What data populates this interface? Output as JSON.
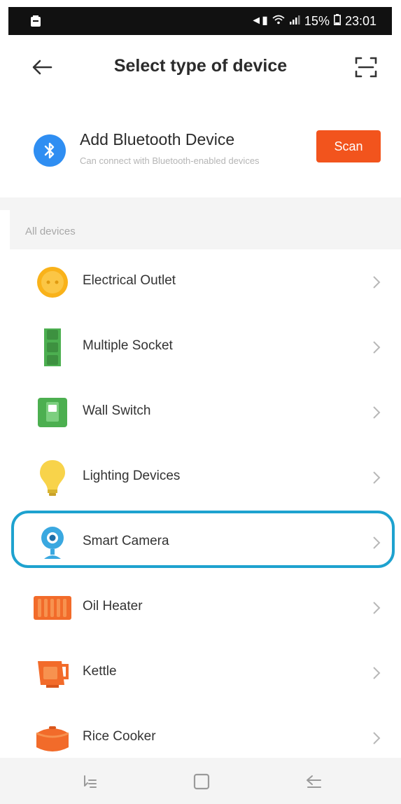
{
  "status_bar": {
    "battery": "15%",
    "time": "23:01"
  },
  "header": {
    "title": "Select type of device"
  },
  "bluetooth": {
    "title": "Add Bluetooth Device",
    "subtitle": "Can connect with Bluetooth-enabled devices",
    "scan_label": "Scan"
  },
  "section": {
    "label": "All devices"
  },
  "devices": [
    {
      "label": "Electrical Outlet",
      "icon": "outlet-icon"
    },
    {
      "label": "Multiple Socket",
      "icon": "power-strip-icon"
    },
    {
      "label": "Wall Switch",
      "icon": "wall-switch-icon"
    },
    {
      "label": "Lighting Devices",
      "icon": "light-bulb-icon"
    },
    {
      "label": "Smart Camera",
      "icon": "camera-icon"
    },
    {
      "label": "Oil Heater",
      "icon": "heater-icon"
    },
    {
      "label": "Kettle",
      "icon": "kettle-icon"
    },
    {
      "label": "Rice Cooker",
      "icon": "rice-cooker-icon"
    }
  ],
  "highlighted_device": "Smart Camera",
  "colors": {
    "accent": "#f2541d",
    "bluetooth": "#2f8ef2",
    "highlight": "#1ea2cf"
  }
}
